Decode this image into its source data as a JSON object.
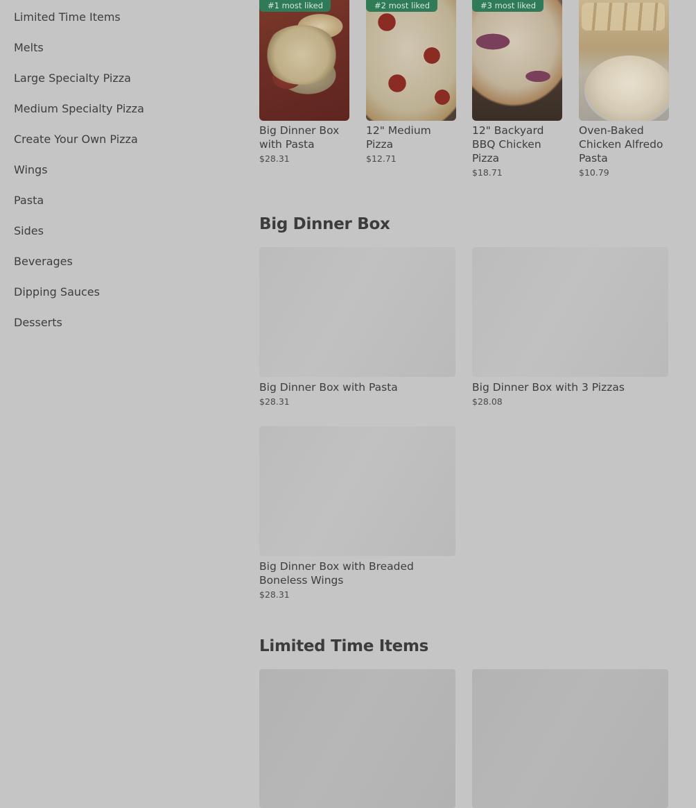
{
  "sidebar": {
    "items": [
      {
        "label": "Limited Time Items"
      },
      {
        "label": "Melts"
      },
      {
        "label": "Large Specialty Pizza"
      },
      {
        "label": "Medium Specialty Pizza"
      },
      {
        "label": "Create Your Own Pizza"
      },
      {
        "label": "Wings"
      },
      {
        "label": "Pasta"
      },
      {
        "label": "Sides"
      },
      {
        "label": "Beverages"
      },
      {
        "label": "Dipping Sauces"
      },
      {
        "label": "Desserts"
      }
    ]
  },
  "most_liked": [
    {
      "badge": "#1 most liked",
      "name": "Big Dinner Box with Pasta",
      "price": "$28.31"
    },
    {
      "badge": "#2 most liked",
      "name": "12\" Medium Pizza",
      "price": "$12.71"
    },
    {
      "badge": "#3 most liked",
      "name": "12\" Backyard BBQ Chicken Pizza",
      "price": "$18.71"
    },
    {
      "badge": "",
      "name": "Oven-Baked Chicken Alfredo Pasta",
      "price": "$10.79"
    }
  ],
  "sections": [
    {
      "title": "Big Dinner Box",
      "items": [
        {
          "name": "Big Dinner Box with Pasta",
          "price": "$28.31"
        },
        {
          "name": "Big Dinner Box with 3 Pizzas",
          "price": "$28.08"
        },
        {
          "name": "Big Dinner Box with Breaded Boneless Wings",
          "price": "$28.31"
        }
      ]
    },
    {
      "title": "Limited Time Items",
      "items": []
    }
  ]
}
